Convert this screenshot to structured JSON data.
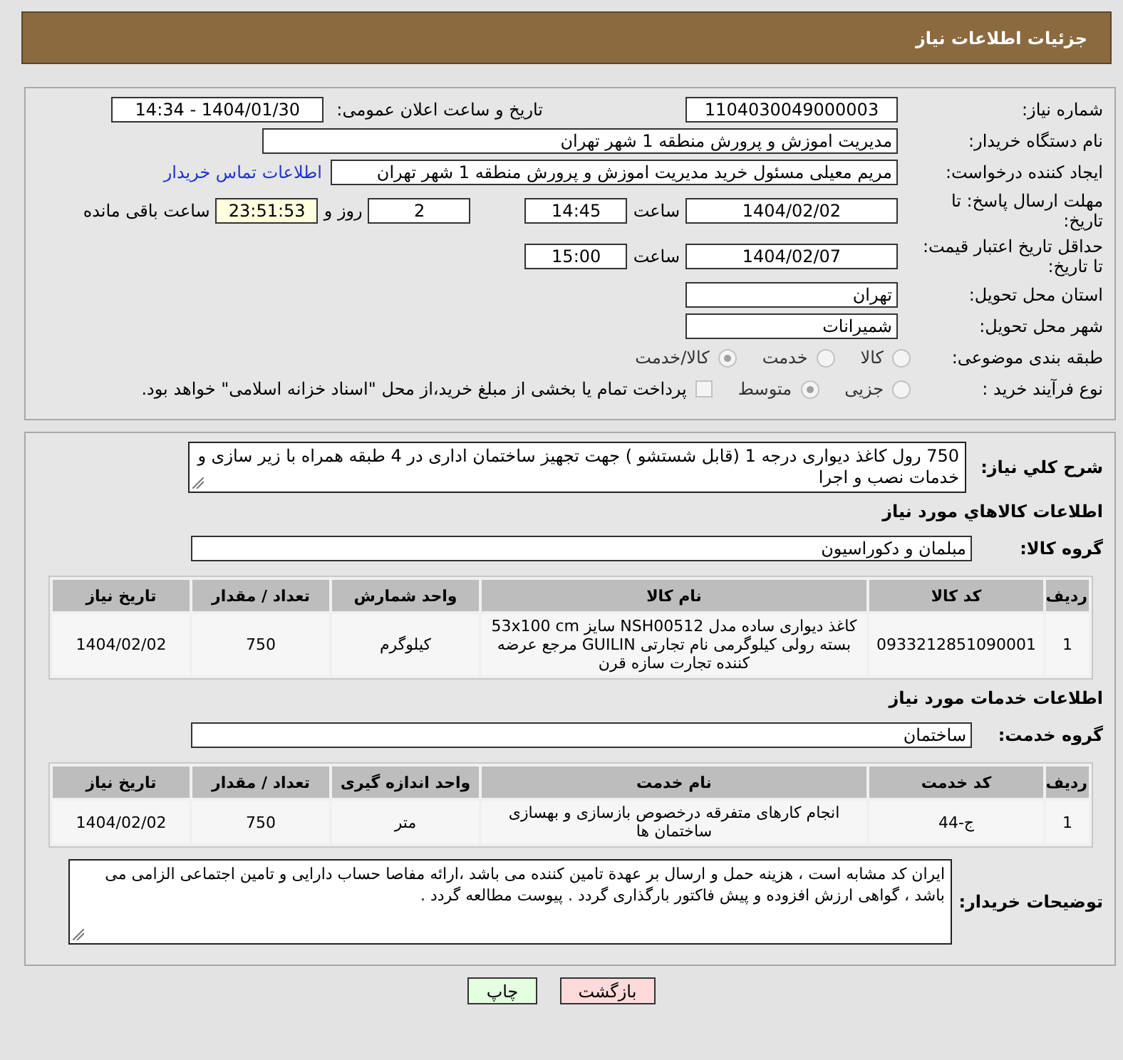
{
  "header": {
    "title": "جزئیات اطلاعات نیاز"
  },
  "need_number": {
    "label": "شماره نیاز:",
    "value": "1104030049000003"
  },
  "announce": {
    "label": "تاریخ و ساعت اعلان عمومی:",
    "value": "1404/01/30 - 14:34"
  },
  "buyer_org": {
    "label": "نام دستگاه خریدار:",
    "value": "مدیریت اموزش و پرورش منطقه 1 شهر تهران"
  },
  "requester": {
    "label": "ایجاد کننده درخواست:",
    "value": "مریم معیلی مسئول خرید  مدیریت اموزش و پرورش منطقه 1 شهر تهران",
    "link": "اطلاعات تماس خریدار"
  },
  "reply_deadline": {
    "label": "مهلت ارسال پاسخ: تا تاریخ:",
    "date": "1404/02/02",
    "time_label": "ساعت",
    "time": "14:45",
    "days": "2",
    "days_label": "روز و",
    "remaining": "23:51:53",
    "remaining_label": "ساعت باقی مانده"
  },
  "price_validity": {
    "label": "حداقل تاریخ اعتبار قیمت: تا تاریخ:",
    "date": "1404/02/07",
    "time_label": "ساعت",
    "time": "15:00"
  },
  "province": {
    "label": "استان محل تحویل:",
    "value": "تهران"
  },
  "city": {
    "label": "شهر محل تحویل:",
    "value": "شمیرانات"
  },
  "category": {
    "label": "طبقه بندی موضوعی:",
    "options": [
      {
        "label": "کالا",
        "selected": false
      },
      {
        "label": "خدمت",
        "selected": false
      },
      {
        "label": "کالا/خدمت",
        "selected": true
      }
    ]
  },
  "process": {
    "label": "نوع فرآیند خرید :",
    "options": [
      {
        "label": "جزیی",
        "selected": false
      },
      {
        "label": "متوسط",
        "selected": true
      }
    ],
    "treasury": {
      "label": "پرداخت تمام یا بخشی از مبلغ خرید،از محل \"اسناد خزانه اسلامی\" خواهد بود.",
      "checked": false
    }
  },
  "description": {
    "label": "شرح كلي نياز:",
    "value": "750 رول کاغذ دیواری درجه 1 (قابل شستشو ) جهت تجهیز  ساختمان اداری در 4 طبقه همراه با زیر سازی و خدمات نصب و اجرا"
  },
  "goods": {
    "title": "اطلاعات كالاهاي مورد نياز",
    "group_label": "گروه کالا:",
    "group": "مبلمان و دکوراسیون",
    "columns": [
      "ردیف",
      "کد کالا",
      "نام کالا",
      "واحد شمارش",
      "تعداد / مقدار",
      "تاریخ نیاز"
    ],
    "rows": [
      [
        "1",
        "0933212851090001",
        "کاغذ دیواری ساده مدل NSH00512 سایز 53x100 cm بسته رولی کیلوگرمی نام تجارتی GUILIN مرجع عرضه کننده تجارت سازه قرن",
        "کیلوگرم",
        "750",
        "1404/02/02"
      ]
    ]
  },
  "services": {
    "title": "اطلاعات خدمات مورد نیاز",
    "group_label": "گروه خدمت:",
    "group": "ساختمان",
    "columns": [
      "ردیف",
      "کد خدمت",
      "نام خدمت",
      "واحد اندازه گیری",
      "تعداد / مقدار",
      "تاریخ نیاز"
    ],
    "rows": [
      [
        "1",
        "ج-44",
        "انجام کارهای متفرقه درخصوص بازسازی و بهسازی ساختمان ها",
        "متر",
        "750",
        "1404/02/02"
      ]
    ]
  },
  "buyer_notes": {
    "label": "توضیحات خریدار:",
    "value": "ایران کد مشابه است ، هزینه حمل و ارسال بر عهدة تامین کننده می باشد ،ارائه مفاصا حساب دارایی و تامین اجتماعی الزامی می باشد ، گواهی ارزش افزوده و پیش فاکتور بارگذاری گردد . پیوست مطالعه گردد ."
  },
  "buttons": [
    {
      "label": "بازگشت",
      "kind": "back"
    },
    {
      "label": "چاپ",
      "kind": "print"
    }
  ]
}
